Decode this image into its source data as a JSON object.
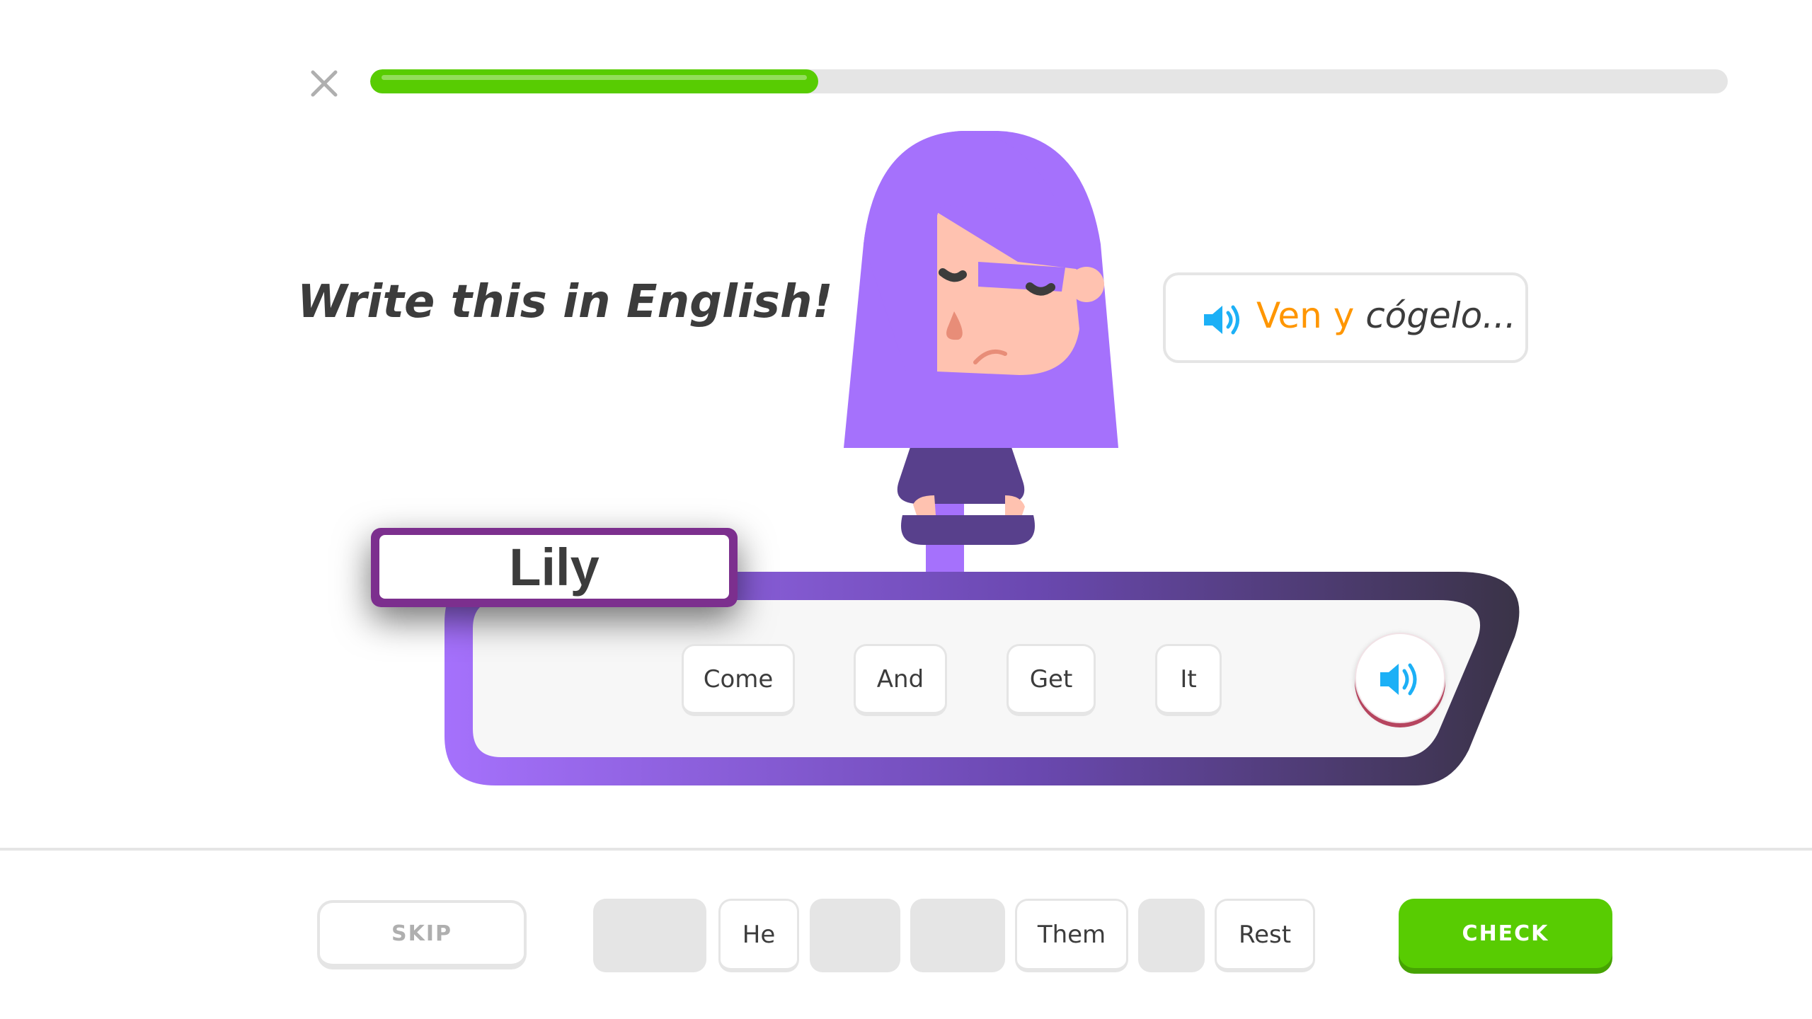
{
  "header": {
    "close_icon": "close-icon",
    "progress": {
      "fraction": 0.33,
      "fill_color": "#58cc02",
      "track_color": "#e5e5e5"
    }
  },
  "prompt": {
    "title": "Write this in English!"
  },
  "bubble": {
    "speaker_icon": "speaker-icon",
    "word_ven": "Ven",
    "word_y": "y",
    "word_rest": "cógelo...",
    "highlight_color": "#ff9600"
  },
  "character": {
    "name_tag": "Lily",
    "hair_color": "#a571fc",
    "shirt_color": "#58408c"
  },
  "answer": {
    "selected_words": [
      {
        "label": "Come"
      },
      {
        "label": "And"
      },
      {
        "label": "Get"
      },
      {
        "label": "It"
      }
    ],
    "speaker_icon": "speaker-icon"
  },
  "word_bank": [
    {
      "label": "",
      "used": true
    },
    {
      "label": "He",
      "used": false
    },
    {
      "label": "",
      "used": true
    },
    {
      "label": "",
      "used": true
    },
    {
      "label": "Them",
      "used": false
    },
    {
      "label": "",
      "used": true
    },
    {
      "label": "Rest",
      "used": false
    }
  ],
  "footer": {
    "skip_label": "SKIP",
    "check_label": "CHECK",
    "check_color": "#58cc02"
  }
}
